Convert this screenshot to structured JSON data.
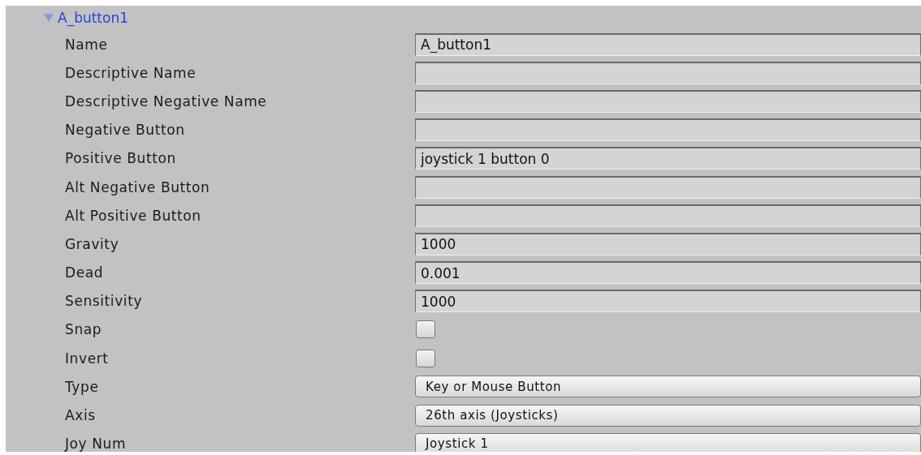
{
  "axis": {
    "name": "A_button1",
    "expanded": true
  },
  "properties": [
    {
      "label": "Name",
      "kind": "text",
      "value": "A_button1"
    },
    {
      "label": "Descriptive Name",
      "kind": "text"
    },
    {
      "label": "Descriptive Negative Name",
      "kind": "text"
    },
    {
      "label": "Negative Button",
      "kind": "text"
    },
    {
      "label": "Positive Button",
      "kind": "text",
      "value": "joystick 1 button 0"
    },
    {
      "label": "Alt Negative Button",
      "kind": "text"
    },
    {
      "label": "Alt Positive Button",
      "kind": "text"
    },
    {
      "label": "Gravity",
      "kind": "text",
      "value": "1000"
    },
    {
      "label": "Dead",
      "kind": "text",
      "value": "0.001"
    },
    {
      "label": "Sensitivity",
      "kind": "text",
      "value": "1000"
    },
    {
      "label": "Snap",
      "kind": "checkbox",
      "checked": false
    },
    {
      "label": "Invert",
      "kind": "checkbox",
      "checked": false
    },
    {
      "label": "Type",
      "kind": "dropdown",
      "value": "Key or Mouse Button"
    },
    {
      "label": "Axis",
      "kind": "dropdown",
      "value": "26th axis (Joysticks)"
    },
    {
      "label": "Joy Num",
      "kind": "dropdown",
      "value": "Joystick 1"
    }
  ]
}
